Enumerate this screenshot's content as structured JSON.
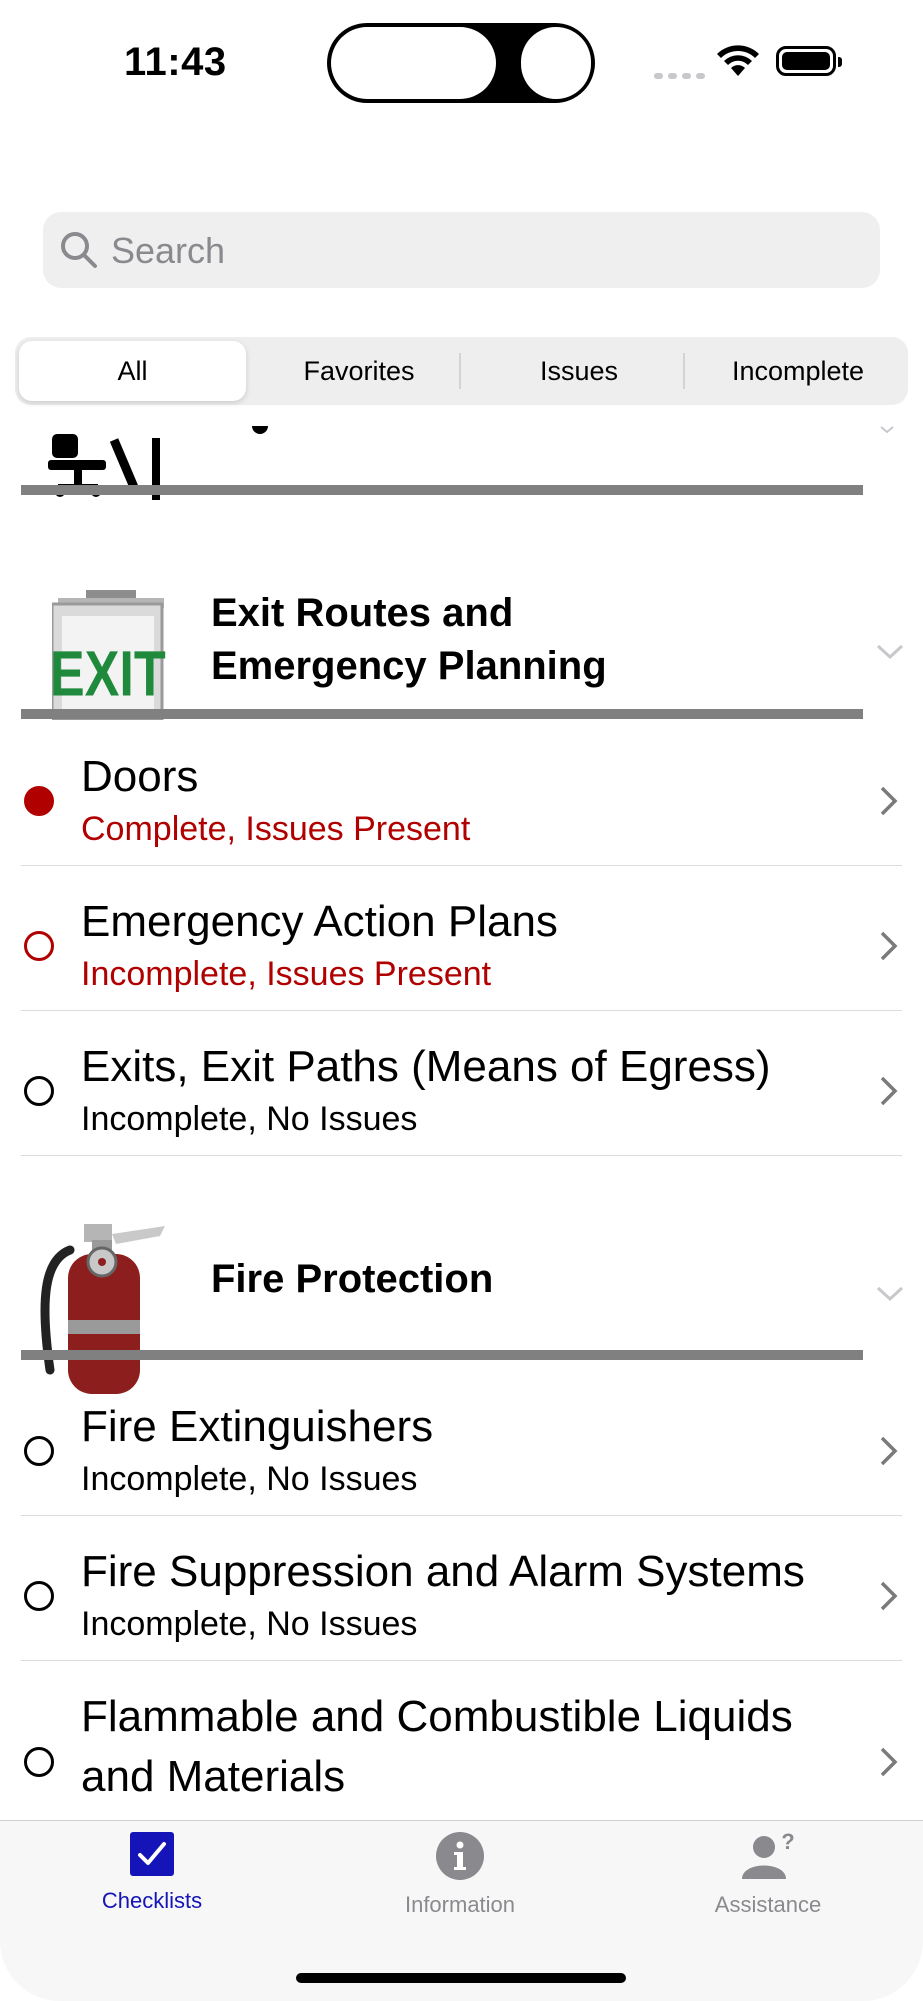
{
  "status_bar": {
    "time": "11:43"
  },
  "search": {
    "placeholder": "Search"
  },
  "segments": [
    {
      "label": "All",
      "selected": true
    },
    {
      "label": "Favorites",
      "selected": false
    },
    {
      "label": "Issues",
      "selected": false
    },
    {
      "label": "Incomplete",
      "selected": false
    }
  ],
  "sections": [
    {
      "title": "Exit Routes and Emergency Planning",
      "title_lines": [
        "Exit Routes and",
        "Emergency Planning"
      ],
      "icon": "exit-sign-icon",
      "items": [
        {
          "title": "Doors",
          "status": "Complete, Issues Present",
          "state": "complete-issues"
        },
        {
          "title": "Emergency Action Plans",
          "status": "Incomplete, Issues Present",
          "state": "incomplete-issues"
        },
        {
          "title": "Exits, Exit Paths (Means of Egress)",
          "status": "Incomplete, No Issues",
          "state": "incomplete"
        }
      ]
    },
    {
      "title": "Fire Protection",
      "icon": "fire-extinguisher-icon",
      "items": [
        {
          "title": "Fire Extinguishers",
          "status": "Incomplete, No Issues",
          "state": "incomplete"
        },
        {
          "title": "Fire Suppression and Alarm Systems",
          "status": "Incomplete, No Issues",
          "state": "incomplete"
        },
        {
          "title": "Flammable and Combustible Liquids and Materials",
          "title_lines": [
            "Flammable and Combustible Liquids",
            "and Materials"
          ],
          "state": "incomplete"
        }
      ]
    }
  ],
  "tabs": [
    {
      "label": "Checklists",
      "icon": "checkbox-icon",
      "active": true
    },
    {
      "label": "Information",
      "icon": "info-icon",
      "active": false
    },
    {
      "label": "Assistance",
      "icon": "person-question-icon",
      "active": false
    }
  ],
  "colors": {
    "issue_red": "#b00000",
    "accent_blue": "#1414b8",
    "gray": "#8a8a8e"
  }
}
